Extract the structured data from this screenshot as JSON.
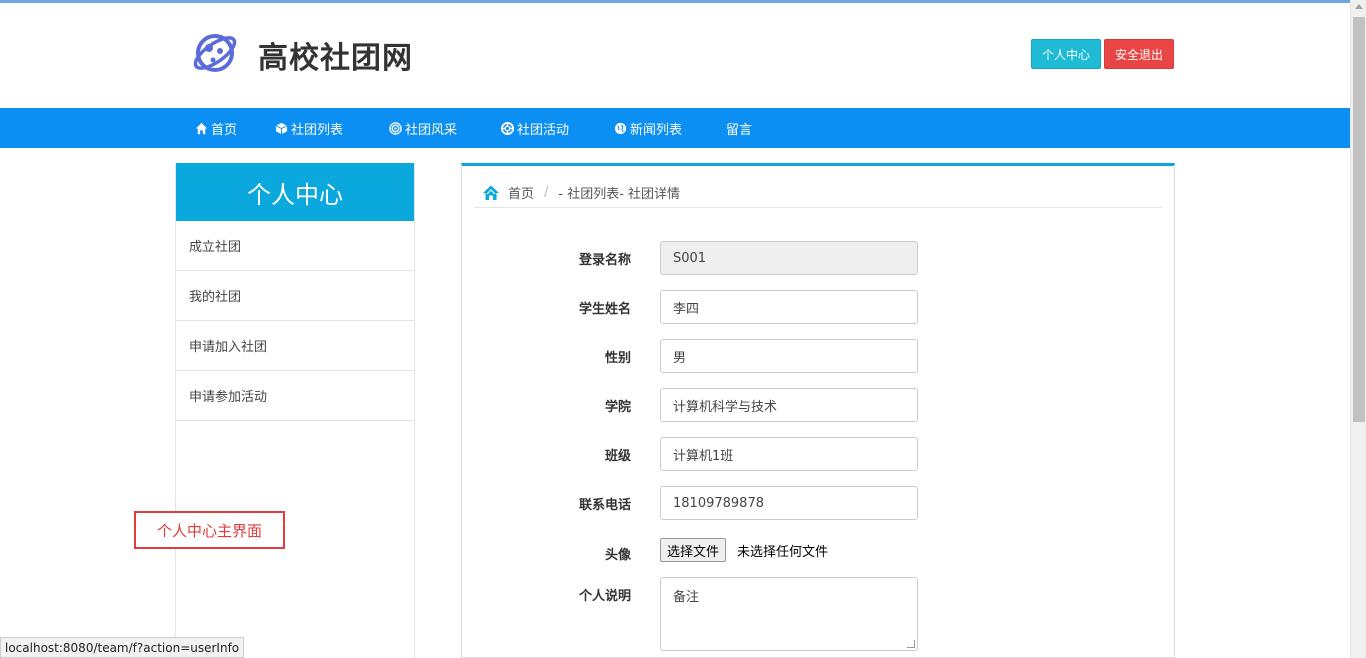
{
  "header": {
    "site_title": "高校社团网",
    "buttons": {
      "personal_center": "个人中心",
      "logout": "安全退出"
    }
  },
  "nav": {
    "items": [
      {
        "label": "首页",
        "icon": "home-icon"
      },
      {
        "label": "社团列表",
        "icon": "cube-icon"
      },
      {
        "label": "社团风采",
        "icon": "target-icon"
      },
      {
        "label": "社团活动",
        "icon": "lifebuoy-icon"
      },
      {
        "label": "新闻列表",
        "icon": "globe-icon"
      },
      {
        "label": "留言",
        "icon": ""
      }
    ]
  },
  "sidebar": {
    "title": "个人中心",
    "items": [
      "成立社团",
      "我的社团",
      "申请加入社团",
      "申请参加活动"
    ]
  },
  "breadcrumb": {
    "home": "首页",
    "sep": "/",
    "current": "- 社团列表- 社团详情"
  },
  "form": {
    "fields": [
      {
        "label": "登录名称",
        "value": "S001"
      },
      {
        "label": "学生姓名",
        "value": "李四"
      },
      {
        "label": "性别",
        "value": "男"
      },
      {
        "label": "学院",
        "value": "计算机科学与技术"
      },
      {
        "label": "班级",
        "value": "计算机1班"
      },
      {
        "label": "联系电话",
        "value": "18109789878"
      }
    ],
    "avatar": {
      "label": "头像",
      "button": "选择文件",
      "status": "未选择任何文件"
    },
    "desc": {
      "label": "个人说明",
      "value": "备注"
    }
  },
  "annotation": "个人中心主界面",
  "status_url": "localhost:8080/team/f?action=userInfo",
  "colors": {
    "nav": "#0c8ff2",
    "accent": "#0aa8dc",
    "danger": "#e94545",
    "info": "#1fbad6"
  }
}
